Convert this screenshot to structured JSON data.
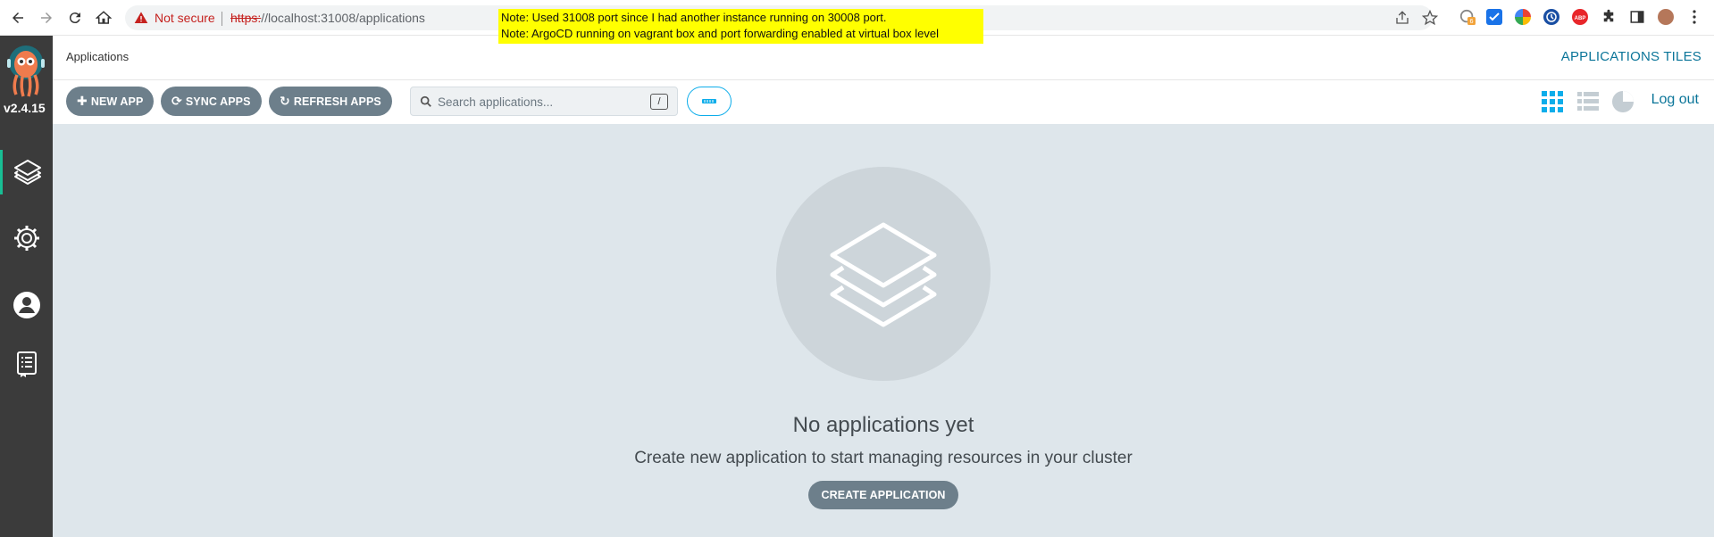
{
  "browser": {
    "not_secure_label": "Not secure",
    "url_scheme": "https:",
    "url_rest": "//localhost:31008/applications",
    "extension_badge": "6"
  },
  "note": {
    "line1": "Note: Used 31008 port since I had another instance running on 30008 port.",
    "line2": "Note: ArgoCD running on vagrant box and port forwarding enabled at virtual box level"
  },
  "sidebar": {
    "version": "v2.4.15",
    "items": [
      {
        "name": "applications",
        "icon": "layers-icon",
        "active": true
      },
      {
        "name": "settings",
        "icon": "gear-icon",
        "active": false
      },
      {
        "name": "user-info",
        "icon": "user-icon",
        "active": false
      },
      {
        "name": "documentation",
        "icon": "docs-icon",
        "active": false
      }
    ]
  },
  "header": {
    "title": "Applications",
    "view_title": "APPLICATIONS TILES"
  },
  "toolbar": {
    "new_app": "NEW APP",
    "sync_apps": "SYNC APPS",
    "refresh_apps": "REFRESH APPS",
    "search_placeholder": "Search applications...",
    "search_shortcut": "/",
    "logout": "Log out"
  },
  "empty_state": {
    "title": "No applications yet",
    "subtitle": "Create new application to start managing resources in your cluster",
    "button": "CREATE APPLICATION"
  },
  "colors": {
    "sidebar_bg": "#3b3b3b",
    "accent": "#0b7599",
    "button_bg": "#6d7f8b",
    "main_bg": "#dee6eb"
  }
}
